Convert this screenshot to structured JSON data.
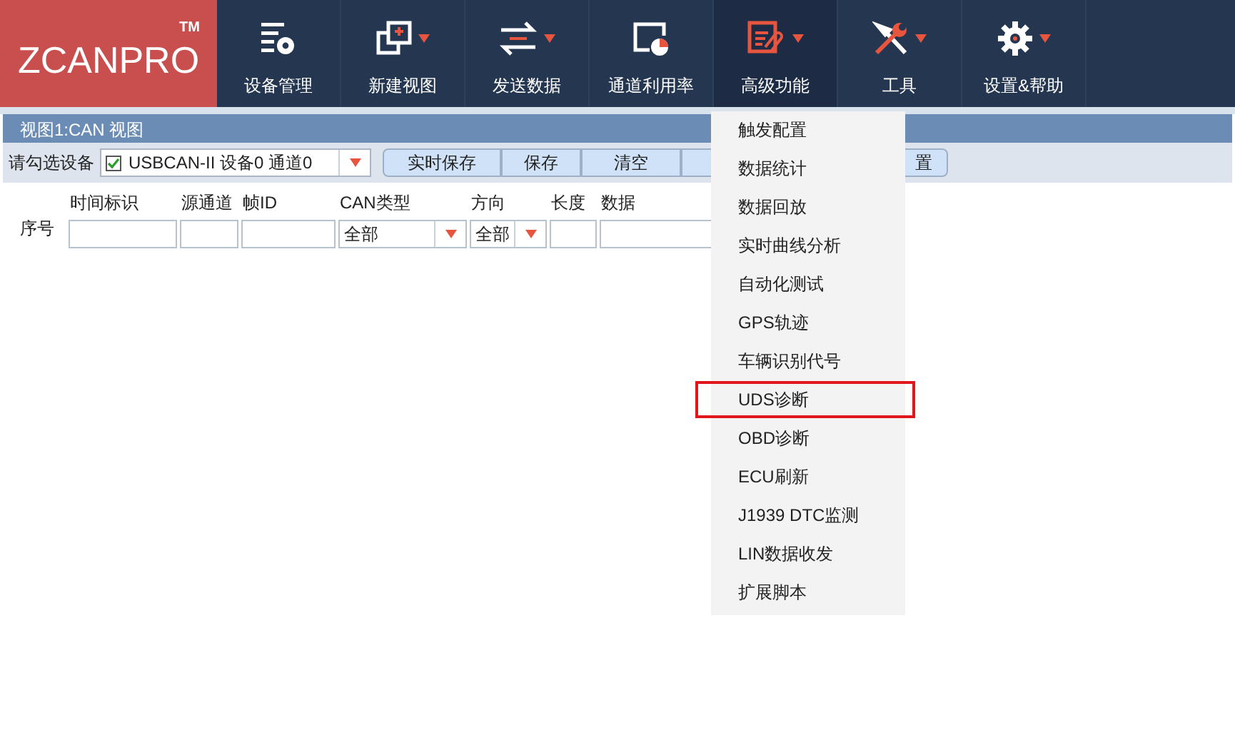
{
  "logo": {
    "text": "ZCANPRO",
    "mark": "TM"
  },
  "nav": [
    {
      "label": "设备管理",
      "dropdown": false,
      "selected": false
    },
    {
      "label": "新建视图",
      "dropdown": true,
      "selected": false
    },
    {
      "label": "发送数据",
      "dropdown": true,
      "selected": false
    },
    {
      "label": "通道利用率",
      "dropdown": false,
      "selected": false
    },
    {
      "label": "高级功能",
      "dropdown": true,
      "selected": true
    },
    {
      "label": "工具",
      "dropdown": true,
      "selected": false
    },
    {
      "label": "设置&帮助",
      "dropdown": true,
      "selected": false
    }
  ],
  "view": {
    "title": "视图1:CAN 视图",
    "device_label": "请勾选设备",
    "device": {
      "text": "USBCAN-II 设备0 通道0",
      "checked": true
    },
    "buttons": [
      "实时保存",
      "保存",
      "清空",
      "置"
    ],
    "row_number": "序号",
    "filters": [
      {
        "label": "时间标识",
        "kind": "input"
      },
      {
        "label": "源通道",
        "kind": "input"
      },
      {
        "label": "帧ID",
        "kind": "input"
      },
      {
        "label": "CAN类型",
        "kind": "select",
        "value": "全部"
      },
      {
        "label": "方向",
        "kind": "select",
        "value": "全部"
      },
      {
        "label": "长度",
        "kind": "input"
      },
      {
        "label": "数据",
        "kind": "input"
      }
    ]
  },
  "menu": [
    {
      "label": "触发配置",
      "highlighted": false
    },
    {
      "label": "数据统计",
      "highlighted": false
    },
    {
      "label": "数据回放",
      "highlighted": false
    },
    {
      "label": "实时曲线分析",
      "highlighted": false
    },
    {
      "label": "自动化测试",
      "highlighted": false
    },
    {
      "label": "GPS轨迹",
      "highlighted": false
    },
    {
      "label": "车辆识别代号",
      "highlighted": false
    },
    {
      "label": "UDS诊断",
      "highlighted": true
    },
    {
      "label": "OBD诊断",
      "highlighted": false
    },
    {
      "label": "ECU刷新",
      "highlighted": false
    },
    {
      "label": "J1939 DTC监测",
      "highlighted": false
    },
    {
      "label": "LIN数据收发",
      "highlighted": false
    },
    {
      "label": "扩展脚本",
      "highlighted": false
    }
  ]
}
